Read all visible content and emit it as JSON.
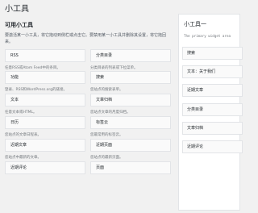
{
  "page": {
    "title": "小工具"
  },
  "available": {
    "title": "可用小工具",
    "description": "要激活某一小工具，将它拖动到侧栏或点击它。要禁用某一小工具并删除其设置，将它拖回来。",
    "widgets": [
      {
        "name": "RSS",
        "desc": "任意RSS或Atom Feed中的条目。"
      },
      {
        "name": "分类目录",
        "desc": "分类目录的列表或下拉菜单。"
      },
      {
        "name": "功能",
        "desc": "登录、RSS和WordPress.org的链接。"
      },
      {
        "name": "搜索",
        "desc": "您站点的搜索表单。"
      },
      {
        "name": "文本",
        "desc": "任意文本或HTML。"
      },
      {
        "name": "文章归档",
        "desc": "您站点文章的月度归档。"
      },
      {
        "name": "日历",
        "desc": "您站点的文章日程表。"
      },
      {
        "name": "标签云",
        "desc": "您最常用的标签云。"
      },
      {
        "name": "近期文章",
        "desc": "您站点中最新的文章。"
      },
      {
        "name": "近期页面",
        "desc": "您站点的最新页面。"
      },
      {
        "name": "近期评论",
        "desc": ""
      },
      {
        "name": "页面",
        "desc": ""
      }
    ]
  },
  "sidebar": {
    "title": "小工具一",
    "description": "The primary widget area",
    "items": [
      "搜索",
      "文本：关于我们",
      "近期文章",
      "分类目录",
      "文章归档",
      "近期评论"
    ]
  }
}
